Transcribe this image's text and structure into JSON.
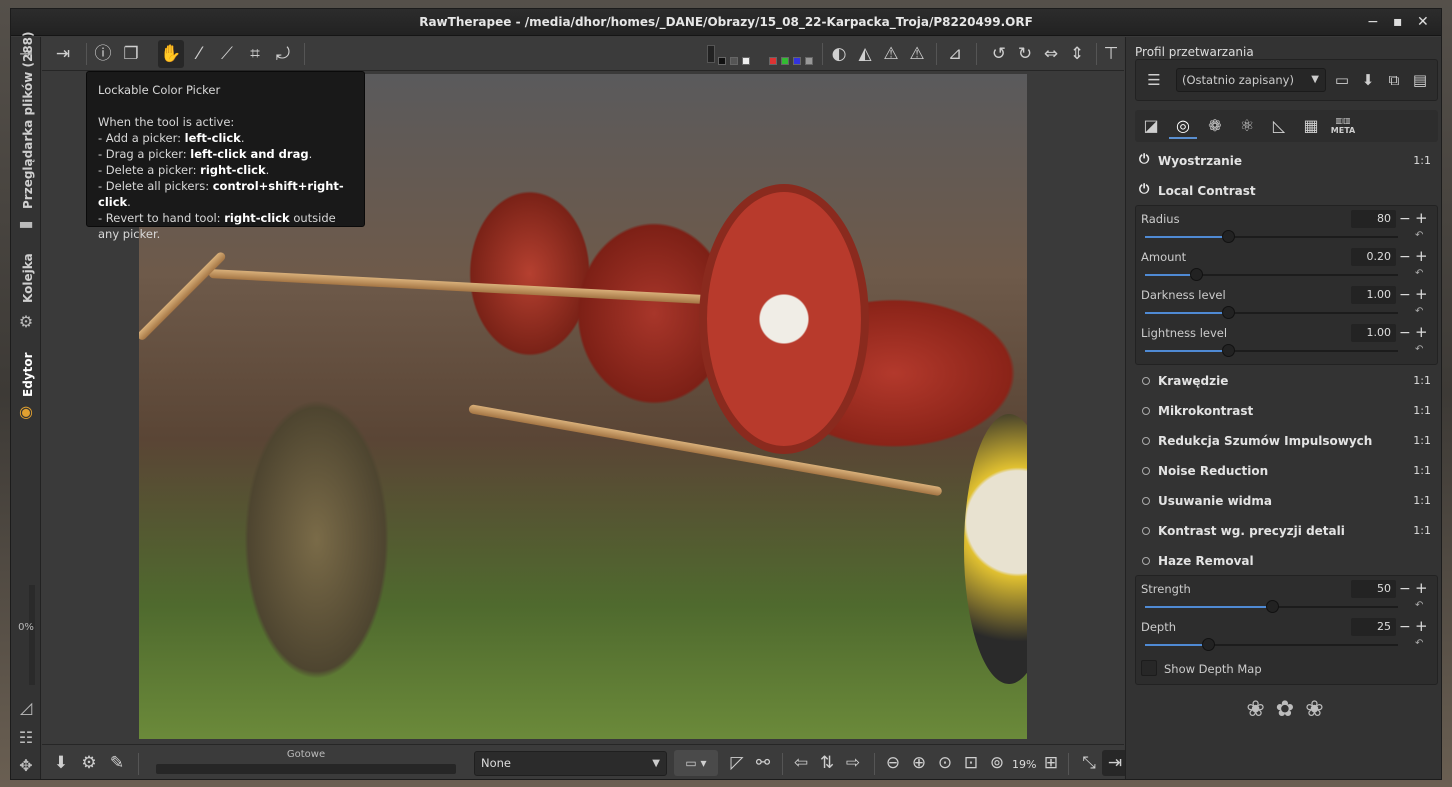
{
  "window": {
    "title": "RawTherapee  - /media/dhor/homes/_DANE/Obrazy/15_08_22-Karpacka_Troja/P8220499.ORF",
    "minimize_icon": "minimize-icon",
    "maximize_icon": "maximize-icon",
    "close_icon": "close-icon"
  },
  "left_tabs": {
    "file_browser": "Przeglądarka plików (288)",
    "queue": "Kolejka",
    "editor": "Edytor",
    "progress_percent": "0%"
  },
  "tooltip": {
    "title": "Lockable Color Picker",
    "intro": "When the tool is active:",
    "lines": [
      {
        "prefix": "- Add a picker: ",
        "key": "left-click",
        "suffix": "."
      },
      {
        "prefix": "- Drag a picker: ",
        "key": "left-click and drag",
        "suffix": "."
      },
      {
        "prefix": "- Delete a picker: ",
        "key": "right-click",
        "suffix": "."
      },
      {
        "prefix": "- Delete all pickers: ",
        "key": "control+shift+right-click",
        "suffix": "."
      },
      {
        "prefix": "- Revert to hand tool: ",
        "key": "right-click",
        "suffix": " outside any picker."
      }
    ]
  },
  "statusbar": {
    "progress_label": "Gotowe",
    "profile_combo": "None",
    "zoom_level": "19%"
  },
  "right_panel": {
    "profile_label": "Profil przetwarzania",
    "profile_value": "(Ostatnio zapisany)",
    "meta_tab_label": "META",
    "tools": [
      {
        "name": "Wyostrzanie",
        "ratio": "1:1"
      },
      {
        "name": "Local Contrast",
        "ratio": "1:1"
      },
      {
        "name": "Krawędzie",
        "ratio": "1:1"
      },
      {
        "name": "Mikrokontrast",
        "ratio": "1:1"
      },
      {
        "name": "Redukcja Szumów Impulsowych",
        "ratio": "1:1"
      },
      {
        "name": "Noise Reduction",
        "ratio": "1:1"
      },
      {
        "name": "Usuwanie widma",
        "ratio": "1:1"
      },
      {
        "name": "Kontrast wg. precyzji detali",
        "ratio": "1:1"
      },
      {
        "name": "Haze Removal",
        "ratio": ""
      }
    ],
    "local_contrast_params": [
      {
        "label": "Radius",
        "value": "80",
        "level": 0.33
      },
      {
        "label": "Amount",
        "value": "0.20",
        "level": 0.2
      },
      {
        "label": "Darkness level",
        "value": "1.00",
        "level": 0.33
      },
      {
        "label": "Lightness level",
        "value": "1.00",
        "level": 0.33
      }
    ],
    "haze_params": [
      {
        "label": "Strength",
        "value": "50",
        "level": 0.5
      },
      {
        "label": "Depth",
        "value": "25",
        "level": 0.25
      }
    ],
    "show_depth_map": "Show Depth Map"
  },
  "colors": {
    "accent": "#4f8ad4"
  }
}
